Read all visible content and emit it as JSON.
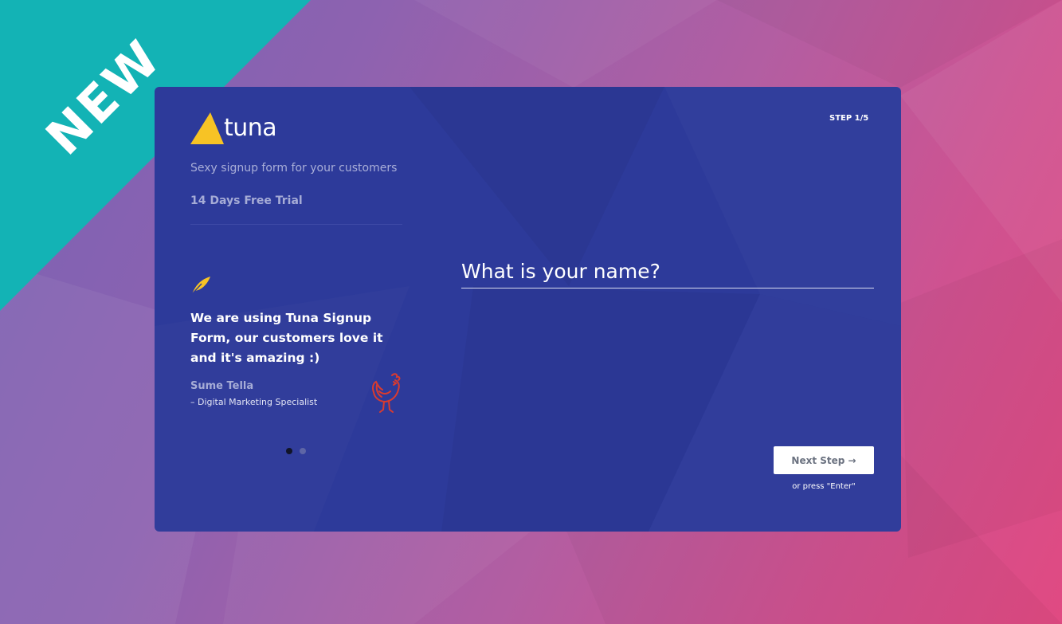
{
  "ribbon": {
    "label": "NEW",
    "color": "#13b3b5"
  },
  "brand": {
    "name": "tuna",
    "logo_icon": "yellow-triangle-icon",
    "accent": "#f7c325"
  },
  "sidebar": {
    "tagline": "Sexy signup form for your customers",
    "trial": "14 Days Free Trial",
    "testimonial": {
      "icon": "feather-icon",
      "quote": "We are using Tuna Signup Form, our customers love it and it's amazing :)",
      "author": "Sume Tella",
      "role": "– Digital Marketing Specialist",
      "author_logo": "rooster-icon"
    },
    "carousel": {
      "total": 2,
      "active": 1
    }
  },
  "form": {
    "step_label": "STEP 1/5",
    "placeholder": "What is your name?",
    "value": "",
    "next_label": "Next Step →",
    "hint": "or press \"Enter\""
  },
  "colors": {
    "card": "#2d3a9a",
    "ribbon": "#13b3b5",
    "rooster": "#d93b2f"
  }
}
